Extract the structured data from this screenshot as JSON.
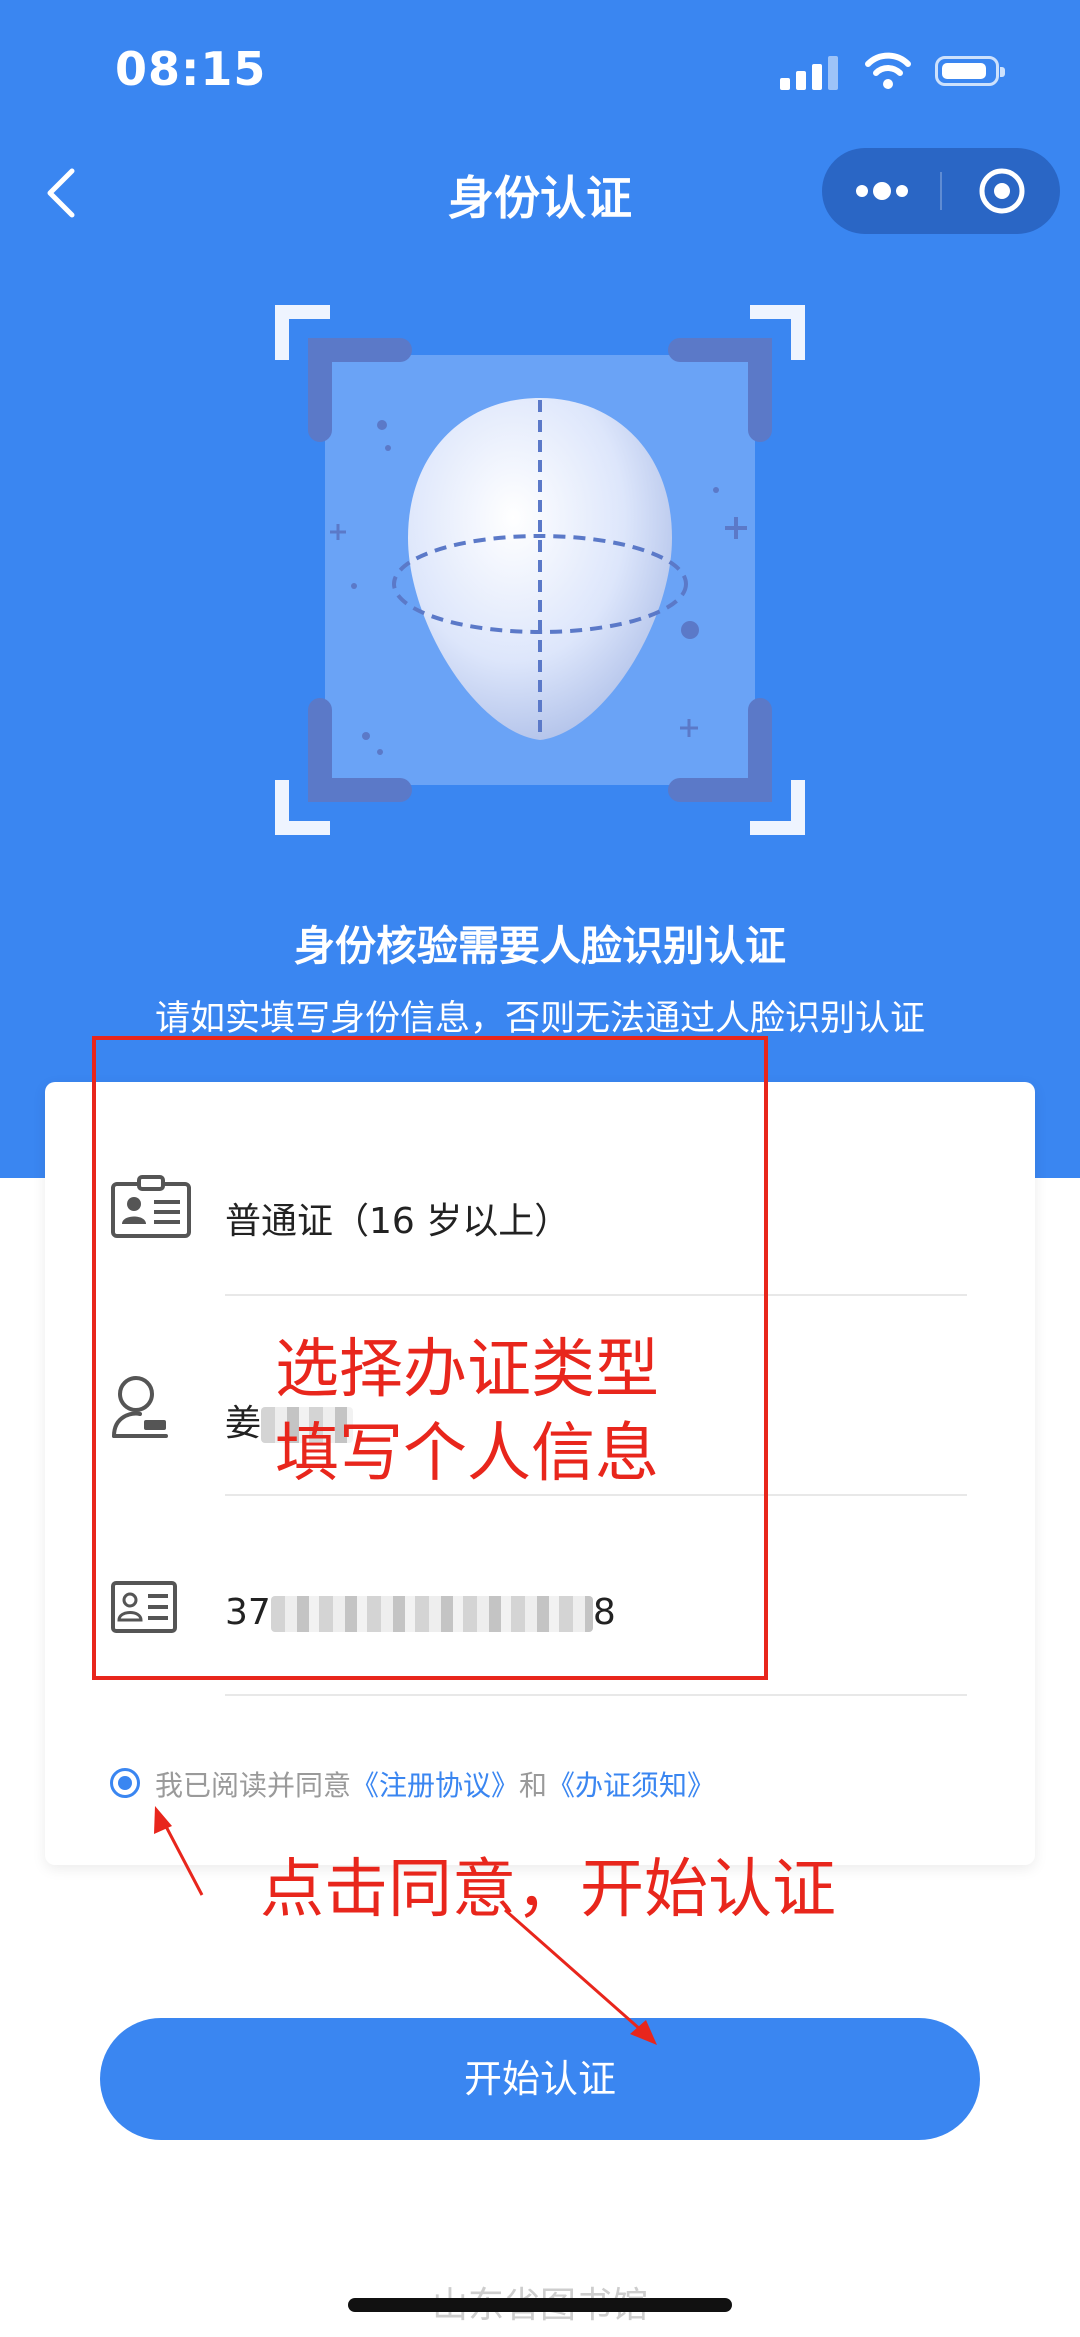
{
  "status_bar": {
    "time": "08:15"
  },
  "nav": {
    "title": "身份认证"
  },
  "hero": {
    "headline": "身份核验需要人脸识别认证",
    "subline": "请如实填写身份信息，否则无法通过人脸识别认证"
  },
  "form": {
    "cert_type": "普通证（16 岁以上）",
    "name_prefix": "姜",
    "id_prefix": "37",
    "id_suffix": "8"
  },
  "agreement": {
    "text": "我已阅读并同意",
    "link1": "《注册协议》",
    "and": "和",
    "link2": "《办证须知》",
    "checked": true
  },
  "start_button": {
    "label": "开始认证"
  },
  "footer": {
    "text": "山东省图书馆"
  },
  "annotations": {
    "line1": "选择办证类型",
    "line2": "填写个人信息",
    "line3": "点击同意，开始认证"
  },
  "colors": {
    "primary": "#3a86f1",
    "annotation": "#e8261c"
  }
}
